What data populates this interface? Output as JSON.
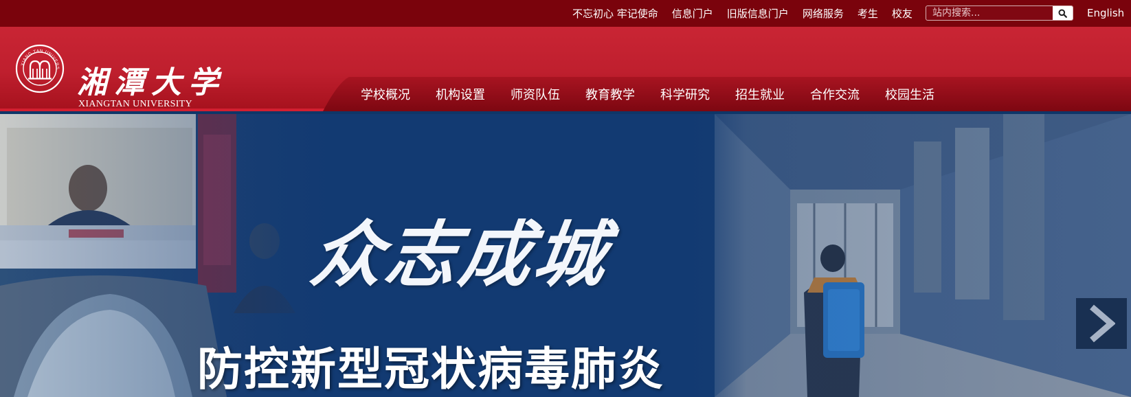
{
  "topbar": {
    "links": [
      "不忘初心 牢记使命",
      "信息门户",
      "旧版信息门户",
      "网络服务",
      "考生",
      "校友"
    ],
    "search_placeholder": "站内搜索...",
    "language_link": "English",
    "icons": {
      "search": "search-icon"
    }
  },
  "header": {
    "logo_cn": "湘潭大学",
    "logo_en": "XIANGTAN UNIVERSITY",
    "emblem_text": "XIANG TAN UNIVERSITY",
    "emblem_icon": "university-emblem-icon",
    "nav": [
      "学校概况",
      "机构设置",
      "师资队伍",
      "教育教学",
      "科学研究",
      "招生就业",
      "合作交流",
      "校园生活"
    ]
  },
  "hero": {
    "headline": "众志成城",
    "subline": "防控新型冠状病毒肺炎",
    "next_icon": "chevron-right-icon"
  },
  "colors": {
    "topbar": "#7a030c",
    "header_red": "#c92534",
    "nav_dark": "#8e0c16",
    "hero_blue": "#123a72"
  }
}
